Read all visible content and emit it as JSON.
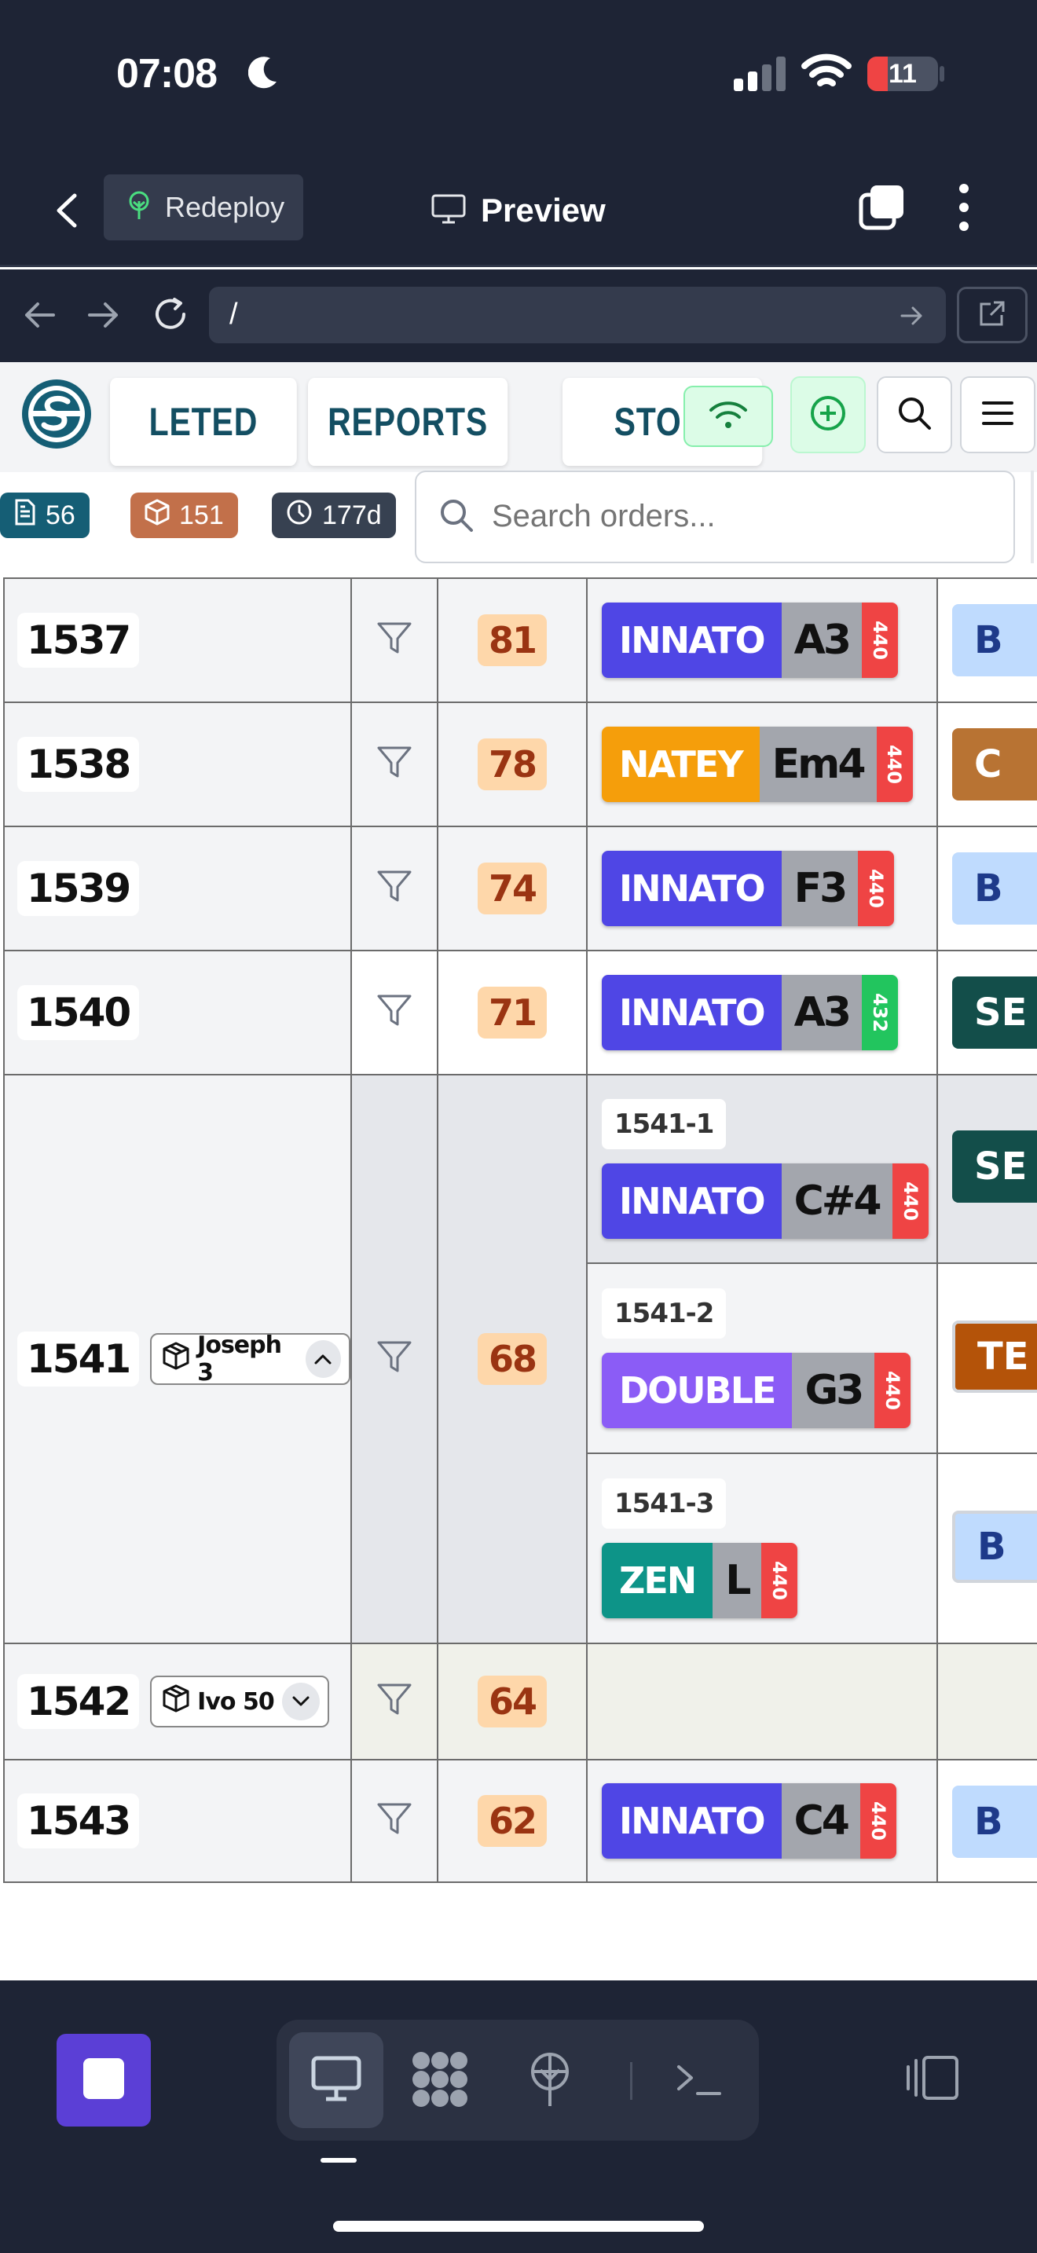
{
  "status_bar": {
    "time": "07:08",
    "battery": "11"
  },
  "browser": {
    "redeploy_label": "Redeploy",
    "preview_label": "Preview",
    "url": "/"
  },
  "app": {
    "tabs": [
      "LETED",
      "REPORTS",
      "STO"
    ],
    "pills": {
      "documents": "56",
      "packages": "151",
      "days": "177d"
    },
    "search": {
      "placeholder": "Search orders..."
    },
    "rows": [
      {
        "id": "1537",
        "score": "81",
        "chips": [
          {
            "brand": "INNATO",
            "note": "A3",
            "tune": "440"
          }
        ],
        "right": "B"
      },
      {
        "id": "1538",
        "score": "78",
        "chips": [
          {
            "brand": "NATEY",
            "note": "Em4",
            "tune": "440"
          }
        ],
        "right": "C"
      },
      {
        "id": "1539",
        "score": "74",
        "chips": [
          {
            "brand": "INNATO",
            "note": "F3",
            "tune": "440"
          }
        ],
        "right": "B"
      },
      {
        "id": "1540",
        "score": "71",
        "chips": [
          {
            "brand": "INNATO",
            "note": "A3",
            "tune": "432"
          }
        ],
        "right": "SE"
      },
      {
        "id": "1541",
        "customer": "Joseph 3",
        "score": "68",
        "subs": [
          {
            "sub_id": "1541-1",
            "brand": "INNATO",
            "note": "C#4",
            "tune": "440",
            "right": "SE"
          },
          {
            "sub_id": "1541-2",
            "brand": "DOUBLE",
            "note": "G3",
            "tune": "440",
            "right": "TE"
          },
          {
            "sub_id": "1541-3",
            "brand": "ZEN",
            "note": "L",
            "tune": "440",
            "right": "B"
          }
        ]
      },
      {
        "id": "1542",
        "customer": "Ivo 50",
        "score": "64"
      },
      {
        "id": "1543",
        "score": "62",
        "chips": [
          {
            "brand": "INNATO",
            "note": "C4",
            "tune": "440"
          }
        ],
        "right": "B"
      }
    ]
  },
  "colors": {
    "innato": "#4f46e5",
    "natey": "#f59e0b",
    "double": "#8b5cf6",
    "zen": "#0d9488",
    "tune_440": "#ef4444",
    "tune_432": "#22c55e",
    "bar_bg": "#1e2435"
  }
}
